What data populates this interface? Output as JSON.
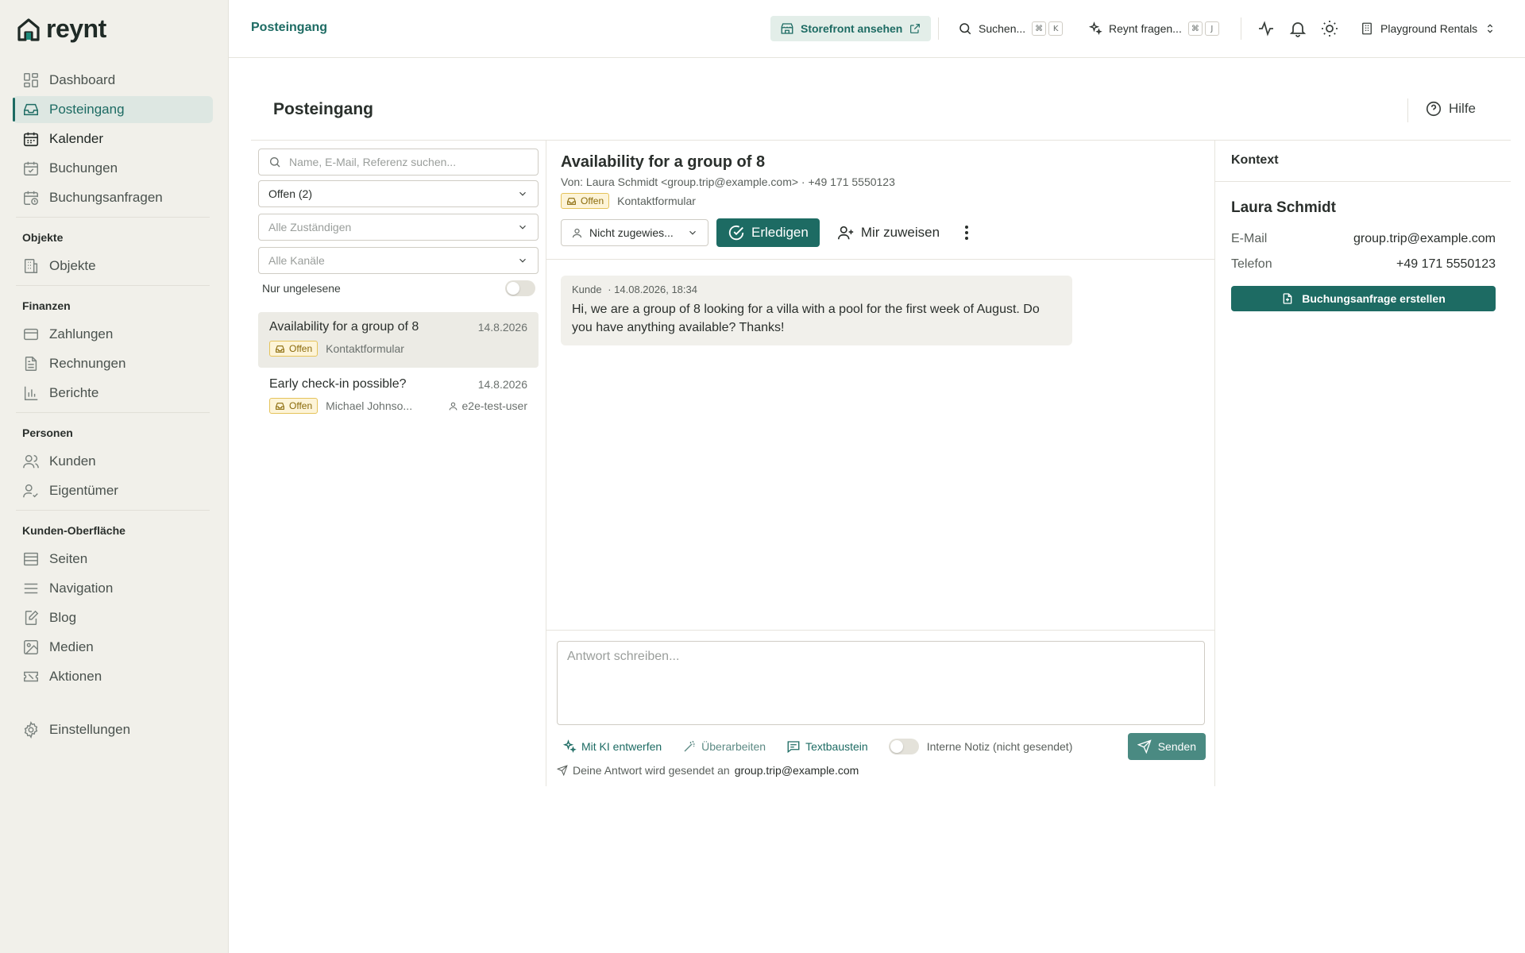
{
  "brand": {
    "name": "reynt"
  },
  "sidebar": {
    "items_main": [
      {
        "label": "Dashboard",
        "icon": "dashboard-icon"
      },
      {
        "label": "Posteingang",
        "icon": "inbox-icon"
      },
      {
        "label": "Kalender",
        "icon": "calendar-icon"
      },
      {
        "label": "Buchungen",
        "icon": "calendar-check-icon"
      },
      {
        "label": "Buchungsanfragen",
        "icon": "calendar-clock-icon"
      }
    ],
    "section_objekte": {
      "title": "Objekte",
      "items": [
        {
          "label": "Objekte",
          "icon": "building-icon"
        }
      ]
    },
    "section_finanzen": {
      "title": "Finanzen",
      "items": [
        {
          "label": "Zahlungen",
          "icon": "credit-card-icon"
        },
        {
          "label": "Rechnungen",
          "icon": "file-text-icon"
        },
        {
          "label": "Berichte",
          "icon": "bar-chart-icon"
        }
      ]
    },
    "section_personen": {
      "title": "Personen",
      "items": [
        {
          "label": "Kunden",
          "icon": "users-icon"
        },
        {
          "label": "Eigentümer",
          "icon": "user-check-icon"
        }
      ]
    },
    "section_kunden": {
      "title": "Kunden-Oberfläche",
      "items": [
        {
          "label": "Seiten",
          "icon": "layout-icon"
        },
        {
          "label": "Navigation",
          "icon": "menu-icon"
        },
        {
          "label": "Blog",
          "icon": "edit-file-icon"
        },
        {
          "label": "Medien",
          "icon": "image-icon"
        },
        {
          "label": "Aktionen",
          "icon": "ticket-icon"
        }
      ]
    },
    "settings": {
      "label": "Einstellungen",
      "icon": "gear-icon"
    }
  },
  "topbar": {
    "title": "Posteingang",
    "storefront_label": "Storefront ansehen",
    "search_label": "Suchen...",
    "search_kbd": [
      "⌘",
      "K"
    ],
    "ask_label": "Reynt fragen...",
    "ask_kbd": [
      "⌘",
      "J"
    ],
    "org_label": "Playground Rentals"
  },
  "page": {
    "title": "Posteingang",
    "help_label": "Hilfe"
  },
  "filters": {
    "search_placeholder": "Name, E-Mail, Referenz suchen...",
    "status_value": "Offen (2)",
    "assignee_placeholder": "Alle Zuständigen",
    "channel_placeholder": "Alle Kanäle",
    "unread_label": "Nur ungelesene"
  },
  "conversations": [
    {
      "title": "Availability for a group of 8",
      "date": "14.8.2026",
      "status": "Offen",
      "source": "Kontaktformular",
      "assignee": ""
    },
    {
      "title": "Early check-in possible?",
      "date": "14.8.2026",
      "status": "Offen",
      "source": "Michael Johnso...",
      "assignee": "e2e-test-user"
    }
  ],
  "detail": {
    "title": "Availability for a group of 8",
    "from": "Von: Laura Schmidt <group.trip@example.com> · +49 171 5550123",
    "status": "Offen",
    "channel": "Kontaktformular",
    "assign_value": "Nicht zugewies...",
    "done_label": "Erledigen",
    "assign_me_label": "Mir zuweisen",
    "message": {
      "author": "Kunde",
      "timestamp": "· 14.08.2026, 18:34",
      "text": "Hi, we are a group of 8 looking for a villa with a pool for the first week of August. Do you have anything available? Thanks!"
    },
    "composer": {
      "placeholder": "Antwort schreiben...",
      "ai_draft_label": "Mit KI entwerfen",
      "revise_label": "Überarbeiten",
      "snippet_label": "Textbaustein",
      "internal_note_label": "Interne Notiz (nicht gesendet)",
      "send_label": "Senden",
      "send_note": "Deine Antwort wird gesendet an",
      "send_to": "group.trip@example.com"
    }
  },
  "context": {
    "title": "Kontext",
    "name": "Laura Schmidt",
    "email_key": "E-Mail",
    "email_value": "group.trip@example.com",
    "phone_key": "Telefon",
    "phone_value": "+49 171 5550123",
    "create_label": "Buchungsanfrage erstellen"
  },
  "colors": {
    "accent": "#1d6b63",
    "sidebar_bg": "#f1f0ea",
    "badge_bg": "#fdf4d8",
    "badge_border": "#e5c35a"
  }
}
